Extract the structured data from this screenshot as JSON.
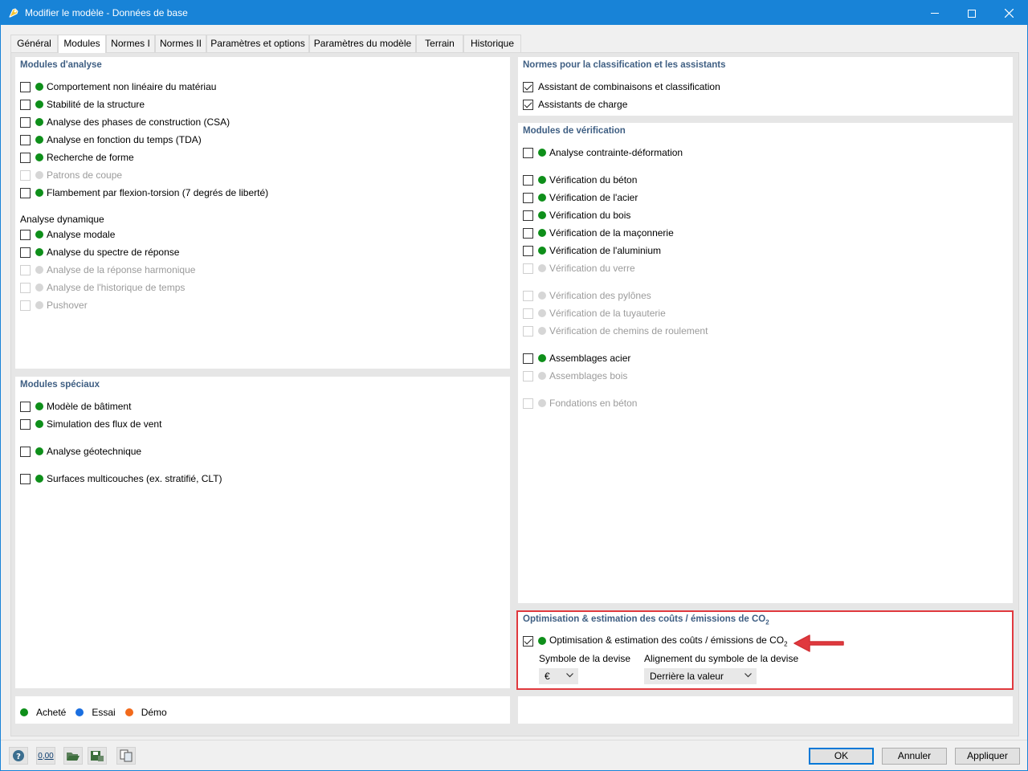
{
  "window": {
    "title": "Modifier le modèle - Données de base"
  },
  "tabs": [
    {
      "label": "Général"
    },
    {
      "label": "Modules"
    },
    {
      "label": "Normes I"
    },
    {
      "label": "Normes II"
    },
    {
      "label": "Paramètres et options"
    },
    {
      "label": "Paramètres du modèle"
    },
    {
      "label": "Terrain"
    },
    {
      "label": "Historique"
    }
  ],
  "active_tab": "Modules",
  "analysis": {
    "title": "Modules d'analyse",
    "items": [
      {
        "label": "Comportement non linéaire du matériau",
        "checked": false,
        "enabled": true
      },
      {
        "label": "Stabilité de la structure",
        "checked": false,
        "enabled": true
      },
      {
        "label": "Analyse des phases de construction (CSA)",
        "checked": false,
        "enabled": true
      },
      {
        "label": "Analyse en fonction du temps (TDA)",
        "checked": false,
        "enabled": true
      },
      {
        "label": "Recherche de forme",
        "checked": false,
        "enabled": true
      },
      {
        "label": "Patrons de coupe",
        "checked": false,
        "enabled": false
      },
      {
        "label": "Flambement par flexion-torsion (7 degrés de liberté)",
        "checked": false,
        "enabled": true
      }
    ],
    "dynamic_title": "Analyse dynamique",
    "dynamic_items": [
      {
        "label": "Analyse modale",
        "checked": false,
        "enabled": true
      },
      {
        "label": "Analyse du spectre de réponse",
        "checked": false,
        "enabled": true
      },
      {
        "label": "Analyse de la réponse harmonique",
        "checked": false,
        "enabled": false
      },
      {
        "label": "Analyse de l'historique de temps",
        "checked": false,
        "enabled": false
      },
      {
        "label": "Pushover",
        "checked": false,
        "enabled": false
      }
    ]
  },
  "special": {
    "title": "Modules spéciaux",
    "items": [
      {
        "label": "Modèle de bâtiment",
        "checked": false,
        "enabled": true
      },
      {
        "label": "Simulation des flux de vent",
        "checked": false,
        "enabled": true
      },
      {
        "label": "Analyse géotechnique",
        "checked": false,
        "enabled": true
      },
      {
        "label": "Surfaces multicouches (ex. stratifié, CLT)",
        "checked": false,
        "enabled": true
      }
    ]
  },
  "legend": {
    "purchased": "Acheté",
    "trial": "Essai",
    "demo": "Démo"
  },
  "standards": {
    "title": "Normes pour la classification et les assistants",
    "items": [
      {
        "label": "Assistant de combinaisons et classification",
        "checked": true,
        "enabled": true
      },
      {
        "label": "Assistants de charge",
        "checked": true,
        "enabled": true
      }
    ]
  },
  "design": {
    "title": "Modules de vérification",
    "items": [
      {
        "label": "Analyse contrainte-déformation",
        "checked": false,
        "enabled": true
      },
      {
        "label": "Vérification du béton",
        "checked": false,
        "enabled": true
      },
      {
        "label": "Vérification de l'acier",
        "checked": false,
        "enabled": true
      },
      {
        "label": "Vérification du bois",
        "checked": false,
        "enabled": true
      },
      {
        "label": "Vérification de la maçonnerie",
        "checked": false,
        "enabled": true
      },
      {
        "label": "Vérification de l'aluminium",
        "checked": false,
        "enabled": true
      },
      {
        "label": "Vérification du verre",
        "checked": false,
        "enabled": false
      },
      {
        "label": "Vérification des pylônes",
        "checked": false,
        "enabled": false
      },
      {
        "label": "Vérification de la tuyauterie",
        "checked": false,
        "enabled": false
      },
      {
        "label": "Vérification de chemins de roulement",
        "checked": false,
        "enabled": false
      },
      {
        "label": "Assemblages acier",
        "checked": false,
        "enabled": true
      },
      {
        "label": "Assemblages bois",
        "checked": false,
        "enabled": false
      },
      {
        "label": "Fondations en béton",
        "checked": false,
        "enabled": false
      }
    ]
  },
  "optimization": {
    "title": "Optimisation & estimation des coûts / émissions de CO",
    "title_sub": "2",
    "item_label": "Optimisation & estimation des coûts / émissions de CO",
    "item_sub": "2",
    "checked": true,
    "currency_label": "Symbole de la devise",
    "currency_value": "€",
    "alignment_label": "Alignement du symbole de la devise",
    "alignment_value": "Derrière la valeur"
  },
  "buttons": {
    "ok": "OK",
    "cancel": "Annuler",
    "apply": "Appliquer"
  },
  "toolbar": {
    "units_text": "0,00"
  },
  "colors": {
    "title_bar": "#1883d7",
    "section_title": "#3f5f83",
    "purchased": "#0e8f1a",
    "trial": "#1a6fe0",
    "demo": "#f26a1b",
    "highlight": "#e0393e"
  }
}
